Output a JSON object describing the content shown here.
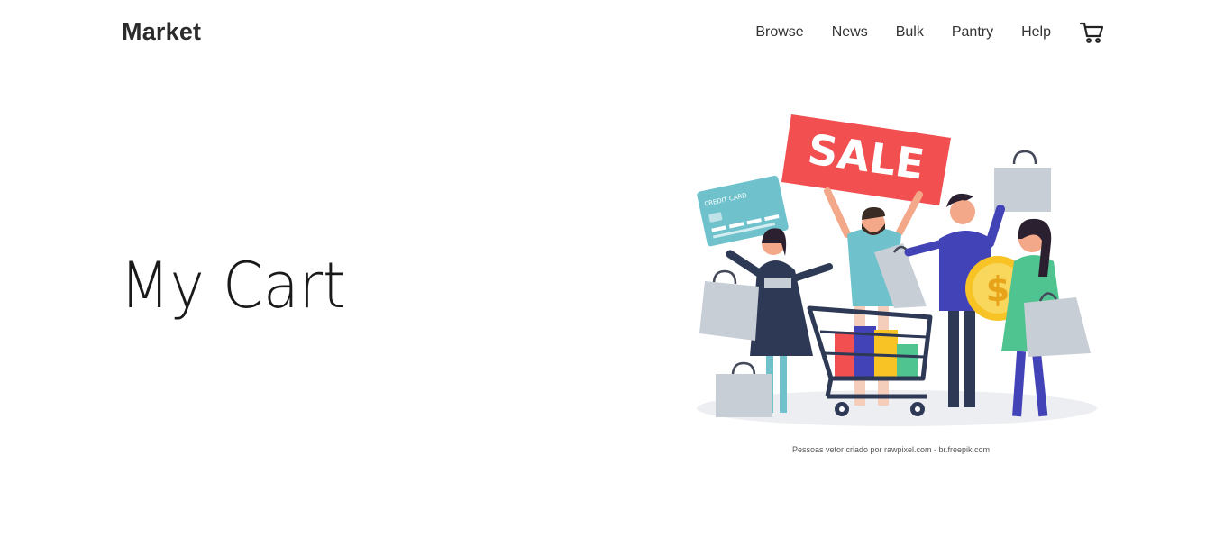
{
  "header": {
    "brand": "Market",
    "nav": [
      "Browse",
      "News",
      "Bulk",
      "Pantry",
      "Help"
    ],
    "cart_icon": "shopping-cart-icon"
  },
  "hero": {
    "title": "My Cart",
    "sale_sign": "SALE",
    "card_label": "CREDIT CARD",
    "coin_symbol": "$",
    "credit": "Pessoas vetor criado por rawpixel.com - br.freepik.com"
  },
  "colors": {
    "sale_red": "#f24f51",
    "card_teal": "#6fc2cc",
    "coin_gold": "#f7c325",
    "navy": "#2e3a55",
    "blue": "#4343b8",
    "green": "#50c490",
    "bag_grey": "#c8ced6"
  }
}
